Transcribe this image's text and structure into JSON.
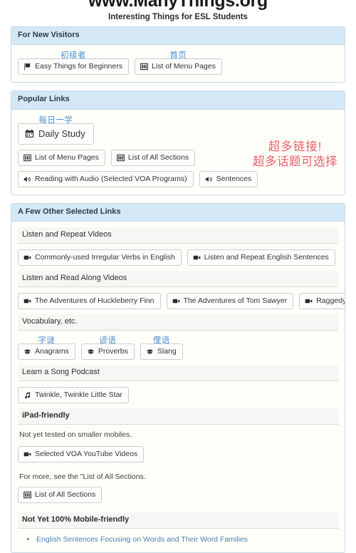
{
  "masthead": {
    "title": "www.ManyThings.org",
    "subtitle": "Interesting Things for ESL Students"
  },
  "panels": {
    "new_visitors": {
      "heading": "For New Visitors",
      "buttons": [
        {
          "label": "Easy Things for Beginners",
          "annotation": "初级者",
          "icon": "flag-icon"
        },
        {
          "label": "List of Menu Pages",
          "annotation": "首页",
          "icon": "columns-icon"
        }
      ]
    },
    "popular_links": {
      "heading": "Popular Links",
      "callout": {
        "line1": "超多链接!",
        "line2": "超多话题可选择",
        "color": "#e8606a"
      },
      "row1": [
        {
          "label": "Daily Study",
          "annotation": "每日一学",
          "icon": "calendar-icon"
        }
      ],
      "row2": [
        {
          "label": "List of Menu Pages",
          "icon": "columns-icon"
        },
        {
          "label": "List of All Sections",
          "icon": "columns-icon"
        }
      ],
      "row3": [
        {
          "label": "Reading with Audio (Selected VOA Programs)",
          "icon": "volume-icon"
        },
        {
          "label": "Sentences",
          "icon": "volume-icon"
        }
      ]
    },
    "other_links": {
      "heading": "A Few Other Selected Links",
      "sections": [
        {
          "title": "Listen and Repeat Videos",
          "buttons": [
            {
              "label": "Commonly-used Irregular Verbs in English",
              "icon": "video-icon"
            },
            {
              "label": "Listen and Repeat English Sentences",
              "icon": "video-icon"
            }
          ]
        },
        {
          "title": "Listen and Read Along Videos",
          "buttons": [
            {
              "label": "The Adventures of Huckleberry Finn",
              "icon": "video-icon"
            },
            {
              "label": "The Adventures of Tom Sawyer",
              "icon": "video-icon"
            },
            {
              "label": "Raggedy Ann",
              "icon": "video-icon"
            }
          ]
        },
        {
          "title": "Vocabulary, etc.",
          "buttons": [
            {
              "label": "Anagrams",
              "annotation": "字谜",
              "icon": "graduation-cap-icon"
            },
            {
              "label": "Proverbs",
              "annotation": "谚语",
              "icon": "graduation-cap-icon"
            },
            {
              "label": "Slang",
              "annotation": "俚语",
              "icon": "graduation-cap-icon"
            }
          ]
        },
        {
          "title": "Learn a Song Podcast",
          "buttons": [
            {
              "label": "Twinkle, Twinkle Little Star",
              "icon": "music-note-icon"
            }
          ]
        }
      ],
      "ipad": {
        "title": "iPad-friendly",
        "note": "Not yet tested on smaller mobiles.",
        "button": {
          "label": "Selected VOA YouTube Videos",
          "icon": "video-icon"
        },
        "more_note": "For more, see the \"List of All Sections.",
        "more_button": {
          "label": "List of All Sections",
          "icon": "columns-icon"
        }
      },
      "not_mobile": {
        "title": "Not Yet 100% Mobile-friendly",
        "links": [
          "English Sentences Focusing on Words and Their Word Families"
        ]
      }
    }
  }
}
